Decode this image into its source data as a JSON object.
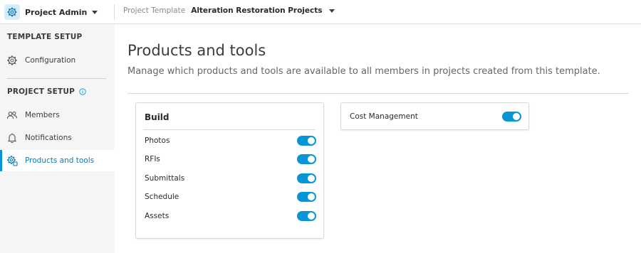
{
  "header": {
    "app_name": "Project Admin",
    "template_label": "Project Template",
    "template_name": "Alteration Restoration Projects"
  },
  "sidebar": {
    "section1": "TEMPLATE SETUP",
    "section2": "PROJECT SETUP",
    "items": [
      {
        "label": "Configuration",
        "icon": "gear-icon"
      },
      {
        "label": "Members",
        "icon": "people-icon"
      },
      {
        "label": "Notifications",
        "icon": "bell-icon"
      },
      {
        "label": "Products and tools",
        "icon": "gear-tools-icon",
        "active": true
      }
    ]
  },
  "main": {
    "title": "Products and tools",
    "subtitle": "Manage which products and tools are available to all members in projects created from this template.",
    "build_card": {
      "title": "Build",
      "rows": [
        {
          "label": "Photos",
          "enabled": true
        },
        {
          "label": "RFIs",
          "enabled": true
        },
        {
          "label": "Submittals",
          "enabled": true
        },
        {
          "label": "Schedule",
          "enabled": true
        },
        {
          "label": "Assets",
          "enabled": true
        }
      ]
    },
    "cost_card": {
      "label": "Cost Management",
      "enabled": true
    }
  },
  "colors": {
    "accent": "#0696d7",
    "sidebar_bg": "#f5f5f5",
    "app_icon_bg": "#d6ecf8"
  }
}
